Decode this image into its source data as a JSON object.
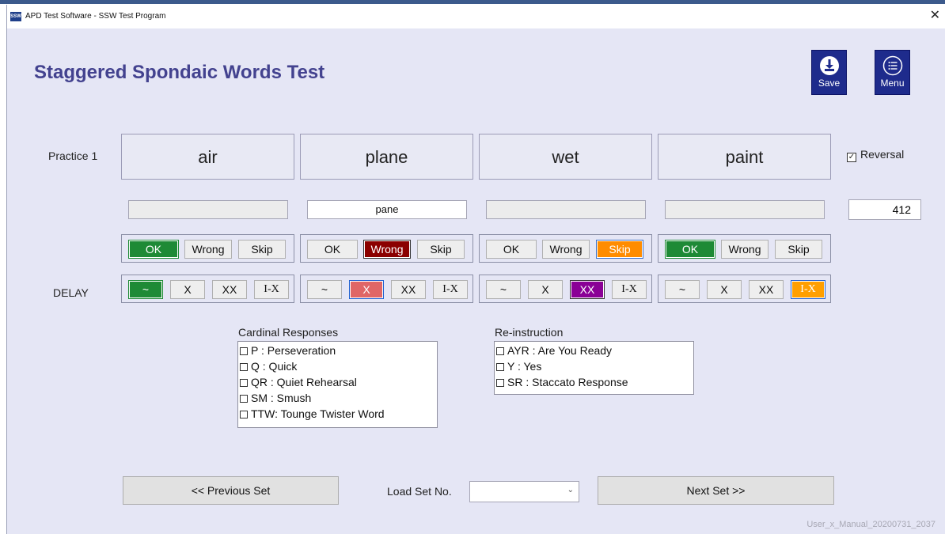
{
  "window": {
    "title": "APD Test Software - SSW Test Program",
    "icon_label": "SSW",
    "close_glyph": "✕"
  },
  "header": {
    "title": "Staggered Spondaic Words Test"
  },
  "toolbar": {
    "save_label": "Save",
    "menu_label": "Menu"
  },
  "row_labels": {
    "practice": "Practice 1",
    "delay": "DELAY"
  },
  "words": [
    "air",
    "plane",
    "wet",
    "paint"
  ],
  "responses": [
    "",
    "pane",
    "",
    ""
  ],
  "reversal": {
    "label": "Reversal",
    "checked": true,
    "glyph": "✓"
  },
  "score": "412",
  "answer_groups": [
    {
      "buttons": [
        "OK",
        "Wrong",
        "Skip"
      ],
      "selected": "OK"
    },
    {
      "buttons": [
        "OK",
        "Wrong",
        "Skip"
      ],
      "selected": "Wrong"
    },
    {
      "buttons": [
        "OK",
        "Wrong",
        "Skip"
      ],
      "selected": "Skip"
    },
    {
      "buttons": [
        "OK",
        "Wrong",
        "Skip"
      ],
      "selected": "OK"
    }
  ],
  "delay_groups": [
    {
      "buttons": [
        "~",
        "X",
        "XX",
        "I-X"
      ],
      "selected": "~"
    },
    {
      "buttons": [
        "~",
        "X",
        "XX",
        "I-X"
      ],
      "selected": "X"
    },
    {
      "buttons": [
        "~",
        "X",
        "XX",
        "I-X"
      ],
      "selected": "XX"
    },
    {
      "buttons": [
        "~",
        "X",
        "XX",
        "I-X"
      ],
      "selected": "I-X"
    }
  ],
  "cardinal": {
    "title": "Cardinal Responses",
    "items": [
      "P : Perseveration",
      "Q : Quick",
      "QR : Quiet Rehearsal",
      "SM : Smush",
      "TTW: Tounge Twister Word"
    ]
  },
  "reinstruction": {
    "title": "Re-instruction",
    "items": [
      "AYR : Are You Ready",
      "Y : Yes",
      "SR : Staccato Response"
    ]
  },
  "nav": {
    "prev_label": "<< Previous Set",
    "next_label": "Next Set >>",
    "load_label": "Load Set No.",
    "load_value": ""
  },
  "watermark": "User_x_Manual_20200731_2037",
  "colors": {
    "title": "#43428f",
    "toolbar_button": "#1e2b8c",
    "ok_selected": "#1e8a36",
    "wrong_selected": "#8b0000",
    "skip_selected": "#ff8c00",
    "x_selected": "#e06666",
    "xx_selected": "#8a0096",
    "ix_selected": "#ff9f00"
  }
}
